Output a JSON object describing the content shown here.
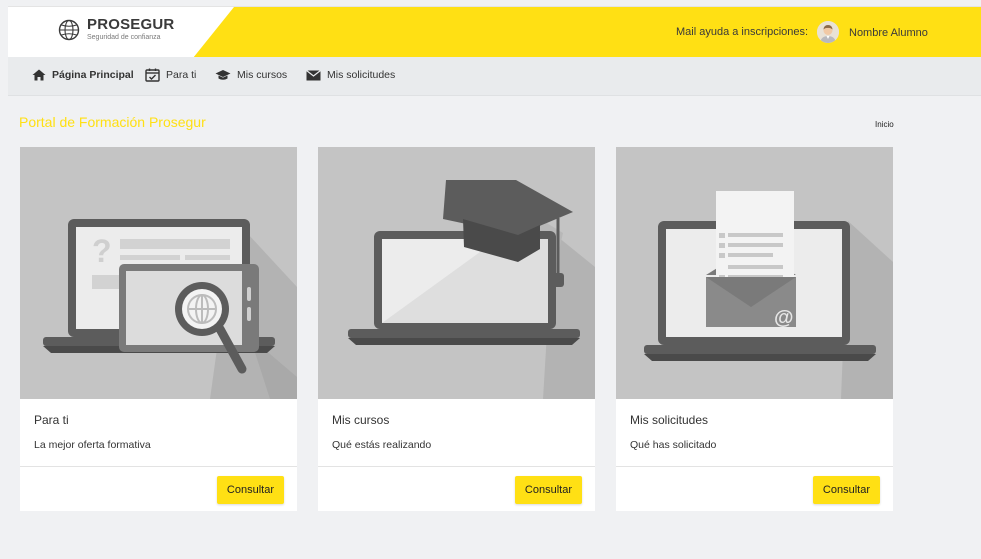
{
  "header": {
    "brand": "PROSEGUR",
    "tagline": "Seguridad de confianza",
    "help_mail_label": "Mail ayuda a inscripciones:",
    "user_name": "Nombre Alumno"
  },
  "nav": {
    "items": [
      {
        "label": "Página Principal",
        "icon": "home-icon"
      },
      {
        "label": "Para ti",
        "icon": "calendar-check-icon"
      },
      {
        "label": "Mis cursos",
        "icon": "graduation-cap-icon"
      },
      {
        "label": "Mis solicitudes",
        "icon": "envelope-icon"
      }
    ]
  },
  "main": {
    "page_title": "Portal de Formación Prosegur",
    "breadcrumb": "Inicio"
  },
  "cards": [
    {
      "title": "Para ti",
      "description": "La mejor oferta formativa",
      "button": "Consultar",
      "illustration": "laptop-tablet-magnifier-icon"
    },
    {
      "title": "Mis cursos",
      "description": "Qué estás realizando",
      "button": "Consultar",
      "illustration": "laptop-graduation-cap-icon"
    },
    {
      "title": "Mis solicitudes",
      "description": "Qué has solicitado",
      "button": "Consultar",
      "illustration": "laptop-envelope-letter-icon"
    }
  ],
  "colors": {
    "accent": "#ffe014",
    "illustration_bg": "#c4c4c4",
    "page_bg": "#f0f1f3"
  }
}
